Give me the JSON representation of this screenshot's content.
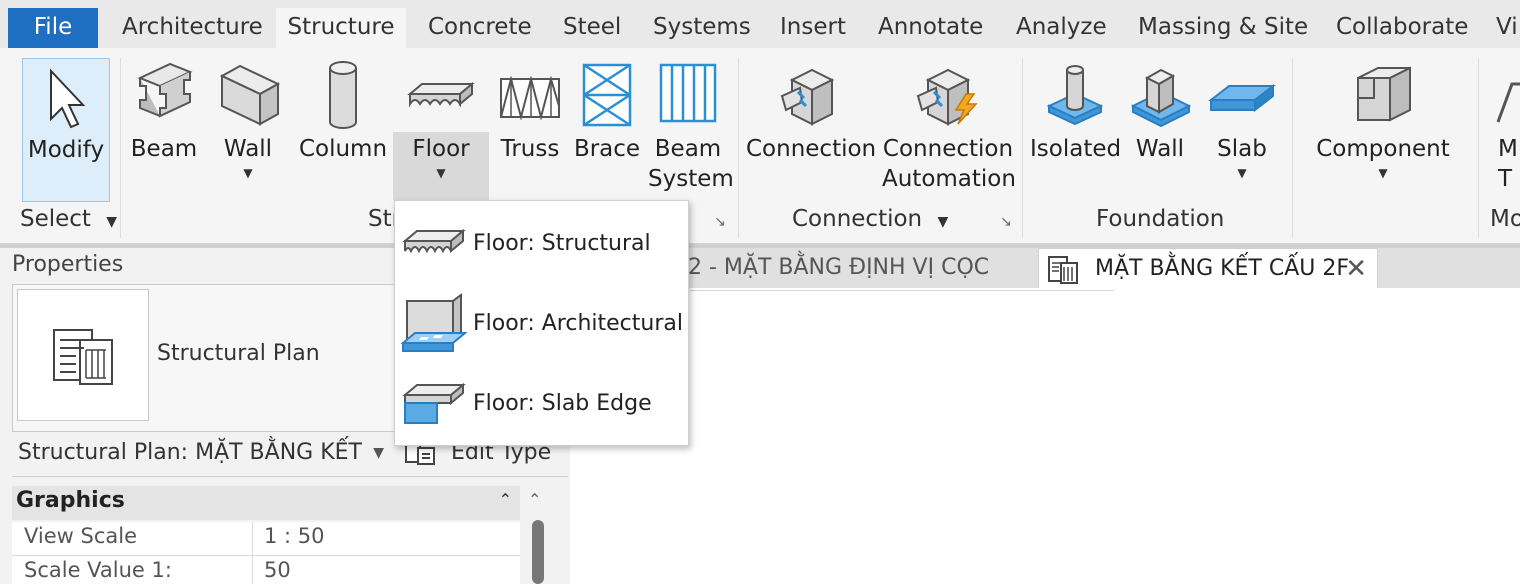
{
  "tabs": [
    "File",
    "Architecture",
    "Structure",
    "Concrete",
    "Steel",
    "Systems",
    "Insert",
    "Annotate",
    "Analyze",
    "Massing & Site",
    "Collaborate",
    "Vi"
  ],
  "active_tab": "Structure",
  "ribbon": {
    "modify_label": "Modify",
    "select_panel": "Select",
    "tools": {
      "beam": "Beam",
      "wall": "Wall",
      "column": "Column",
      "floor": "Floor",
      "truss": "Truss",
      "brace": "Brace",
      "beam_system_1": "Beam",
      "beam_system_2": "System",
      "connection": "Connection",
      "connection_automation_1": "Connection",
      "connection_automation_2": "Automation",
      "isolated": "Isolated",
      "found_wall": "Wall",
      "slab": "Slab",
      "component": "Component",
      "model_partial_1": "M",
      "model_partial_2": "T"
    },
    "panels": {
      "structure": "Str",
      "connection": "Connection",
      "foundation": "Foundation",
      "model_partial": "Mo"
    }
  },
  "floor_menu": {
    "items": [
      "Floor: Structural",
      "Floor: Architectural",
      "Floor: Slab Edge"
    ]
  },
  "properties": {
    "title": "Properties",
    "type_name": "Structural Plan",
    "type_selector": "Structural Plan: MẶT BẰNG KẾT",
    "edit_type": "Edit Type",
    "section": "Graphics",
    "rows": [
      {
        "name": "View Scale",
        "value": "1 : 50"
      },
      {
        "name": "Scale Value    1:",
        "value": "50"
      }
    ]
  },
  "views": {
    "tab1": "2 - MẶT BẰNG ĐỊNH VỊ CỌC",
    "tab2": "MẶT BẰNG KẾT CẤU 2F"
  },
  "colors": {
    "file_tab": "#1e6ec2",
    "accent_blue": "#2b8fd6",
    "modify_highlight": "#ddeefa",
    "floor_highlight": "#d9d9d9"
  }
}
